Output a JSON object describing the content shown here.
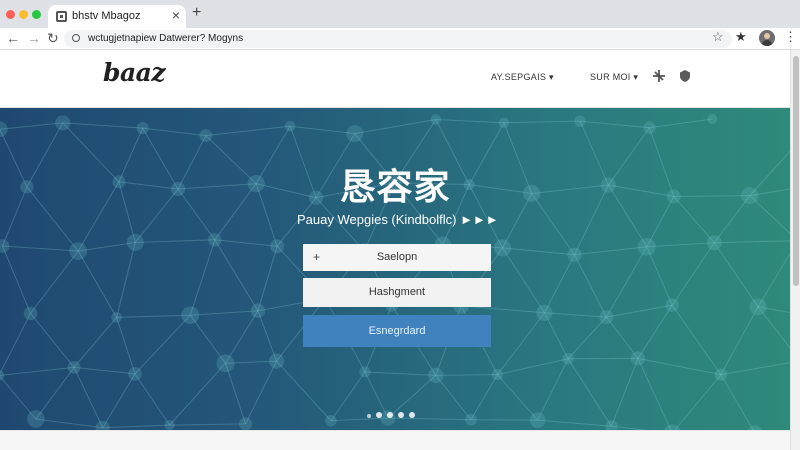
{
  "browser": {
    "tab_title": "bhstv Mbagoz",
    "tab_close": "×",
    "new_tab": "+",
    "url": "wctugjetnapiew Datwerer? Mogyns",
    "nav_back": "←",
    "nav_forward": "→",
    "nav_reload": "↻",
    "bookmark_icon": "☆",
    "bookmarked_icon": "★",
    "menu_icon": "⋮"
  },
  "site": {
    "logo": "baaz",
    "nav": [
      {
        "label": "AY.SEPGAIS ▾"
      },
      {
        "label": "SUR MOI ▾"
      }
    ]
  },
  "hero": {
    "title": "恳容家",
    "subtitle": "Pauay Wepgies  (Kindbolflc)  ►►►",
    "buttons": [
      {
        "label": "Saelopn",
        "icon": "+"
      },
      {
        "label": "Hashgment"
      },
      {
        "label": "Esnegrdard"
      }
    ],
    "colors": {
      "gradient_left": "#1f4870",
      "gradient_right": "#2f8a7a",
      "primary_button": "#3f82be"
    }
  }
}
